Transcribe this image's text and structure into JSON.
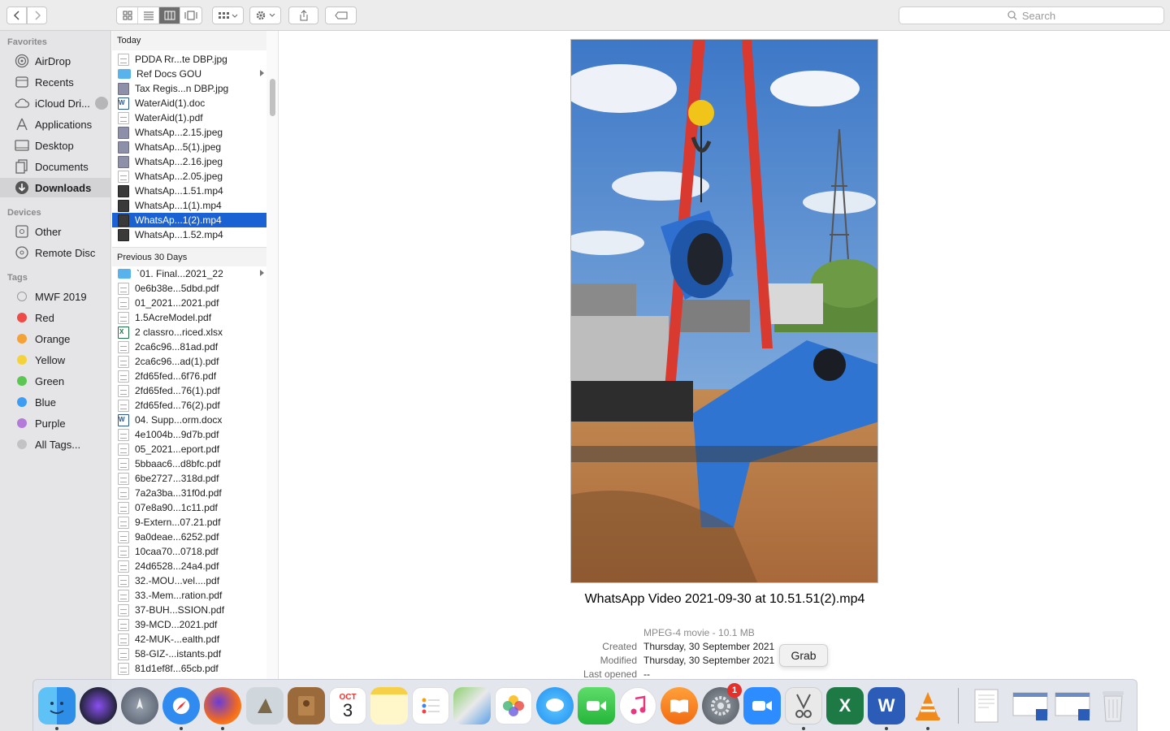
{
  "toolbar": {
    "search_placeholder": "Search"
  },
  "sidebar": {
    "favorites_header": "Favorites",
    "favorites": [
      {
        "label": "AirDrop",
        "icon": "airdrop-icon"
      },
      {
        "label": "Recents",
        "icon": "recents-icon"
      },
      {
        "label": "iCloud Dri...",
        "icon": "icloud-icon"
      },
      {
        "label": "Applications",
        "icon": "applications-icon"
      },
      {
        "label": "Desktop",
        "icon": "desktop-icon"
      },
      {
        "label": "Documents",
        "icon": "documents-icon"
      },
      {
        "label": "Downloads",
        "icon": "downloads-icon"
      }
    ],
    "devices_header": "Devices",
    "devices": [
      {
        "label": "Other",
        "icon": "disk-icon"
      },
      {
        "label": "Remote Disc",
        "icon": "disc-icon"
      }
    ],
    "tags_header": "Tags",
    "tags": [
      {
        "label": "MWF 2019",
        "color": "#e5e5e7"
      },
      {
        "label": "Red",
        "color": "#ee4b46"
      },
      {
        "label": "Orange",
        "color": "#f4a136"
      },
      {
        "label": "Yellow",
        "color": "#f6d23a"
      },
      {
        "label": "Green",
        "color": "#5bc652"
      },
      {
        "label": "Blue",
        "color": "#3d9cf3"
      },
      {
        "label": "Purple",
        "color": "#b37ad9"
      },
      {
        "label": "All Tags...",
        "color": "#c3c3c6"
      }
    ]
  },
  "column": {
    "today_header": "Today",
    "today_files": [
      {
        "name": "PDDA Rr...te DBP.jpg",
        "type": "doc"
      },
      {
        "name": "Ref Docs GOU",
        "type": "folder"
      },
      {
        "name": "Tax Regis...n DBP.jpg",
        "type": "img"
      },
      {
        "name": "WaterAid(1).doc",
        "type": "word"
      },
      {
        "name": "WaterAid(1).pdf",
        "type": "pdf"
      },
      {
        "name": "WhatsAp...2.15.jpeg",
        "type": "img"
      },
      {
        "name": "WhatsAp...5(1).jpeg",
        "type": "img"
      },
      {
        "name": "WhatsAp...2.16.jpeg",
        "type": "img"
      },
      {
        "name": "WhatsAp...2.05.jpeg",
        "type": "doc"
      },
      {
        "name": "WhatsAp...1.51.mp4",
        "type": "vid"
      },
      {
        "name": "WhatsAp...1(1).mp4",
        "type": "vid"
      },
      {
        "name": "WhatsAp...1(2).mp4",
        "type": "vid"
      },
      {
        "name": "WhatsAp...1.52.mp4",
        "type": "vid"
      }
    ],
    "prev_header": "Previous 30 Days",
    "prev_files": [
      {
        "name": "`01. Final...2021_22",
        "type": "folder"
      },
      {
        "name": "0e6b38e...5dbd.pdf",
        "type": "pdf"
      },
      {
        "name": "01_2021...2021.pdf",
        "type": "pdf"
      },
      {
        "name": "1.5AcreModel.pdf",
        "type": "pdf"
      },
      {
        "name": "2 classro...riced.xlsx",
        "type": "excel"
      },
      {
        "name": "2ca6c96...81ad.pdf",
        "type": "pdf"
      },
      {
        "name": "2ca6c96...ad(1).pdf",
        "type": "pdf"
      },
      {
        "name": "2fd65fed...6f76.pdf",
        "type": "pdf"
      },
      {
        "name": "2fd65fed...76(1).pdf",
        "type": "pdf"
      },
      {
        "name": "2fd65fed...76(2).pdf",
        "type": "pdf"
      },
      {
        "name": "04. Supp...orm.docx",
        "type": "word"
      },
      {
        "name": "4e1004b...9d7b.pdf",
        "type": "pdf"
      },
      {
        "name": "05_2021...eport.pdf",
        "type": "pdf"
      },
      {
        "name": "5bbaac6...d8bfc.pdf",
        "type": "pdf"
      },
      {
        "name": "6be2727...318d.pdf",
        "type": "pdf"
      },
      {
        "name": "7a2a3ba...31f0d.pdf",
        "type": "pdf"
      },
      {
        "name": "07e8a90...1c11.pdf",
        "type": "pdf"
      },
      {
        "name": "9-Extern...07.21.pdf",
        "type": "pdf"
      },
      {
        "name": "9a0deae...6252.pdf",
        "type": "pdf"
      },
      {
        "name": "10caa70...0718.pdf",
        "type": "pdf"
      },
      {
        "name": "24d6528...24a4.pdf",
        "type": "pdf"
      },
      {
        "name": "32.-MOU...vel....pdf",
        "type": "pdf"
      },
      {
        "name": "33.-Mem...ration.pdf",
        "type": "pdf"
      },
      {
        "name": "37-BUH...SSION.pdf",
        "type": "pdf"
      },
      {
        "name": "39-MCD...2021.pdf",
        "type": "pdf"
      },
      {
        "name": "42-MUK-...ealth.pdf",
        "type": "pdf"
      },
      {
        "name": "58-GIZ-...istants.pdf",
        "type": "pdf"
      },
      {
        "name": "81d1ef8f...65cb.pdf",
        "type": "pdf"
      }
    ]
  },
  "preview": {
    "title": "WhatsApp Video 2021-09-30 at 10.51.51(2).mp4",
    "kind": "MPEG-4 movie - 10.1 MB",
    "created_label": "Created",
    "created_value": "Thursday, 30 September 2021",
    "modified_label": "Modified",
    "modified_value": "Thursday, 30 September 2021",
    "last_opened_label": "Last opened",
    "last_opened_value": "--"
  },
  "dock": {
    "tooltip": "Grab",
    "calendar_month": "OCT",
    "calendar_day": "3",
    "settings_badge": "1"
  }
}
